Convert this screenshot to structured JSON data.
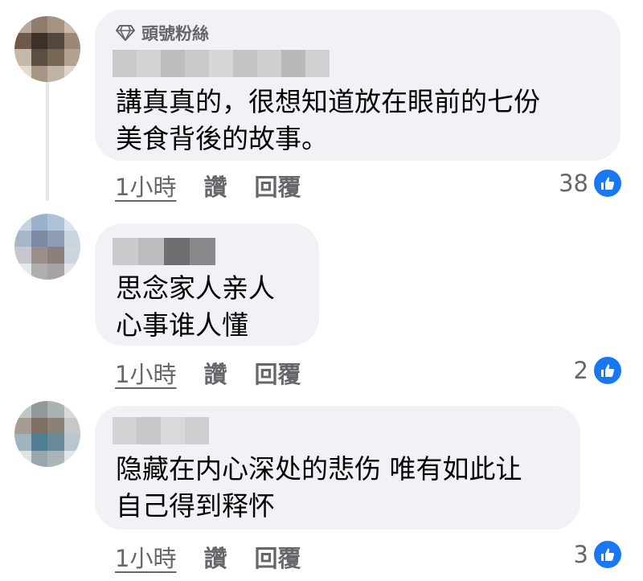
{
  "comments": [
    {
      "badge": "頭號粉絲",
      "text_lines": [
        "講真真的，很想知道放在眼前的七份",
        "美食背後的故事。"
      ],
      "time": "1小時",
      "like_label": "讚",
      "reply_label": "回覆",
      "reaction_count": "38"
    },
    {
      "text_lines": [
        "思念家人亲人",
        "心事谁人懂"
      ],
      "time": "1小時",
      "like_label": "讚",
      "reply_label": "回覆",
      "reaction_count": "2"
    },
    {
      "text_lines": [
        "隐藏在内心深处的悲伤 唯有如此让",
        "自己得到释怀"
      ],
      "time": "1小時",
      "like_label": "讚",
      "reply_label": "回覆",
      "reaction_count": "3"
    }
  ],
  "colors": {
    "bubble": "#f0f2f5",
    "secondary_text": "#65676b",
    "like_blue": "#1877f2"
  },
  "icons": {
    "badge": "diamond-icon",
    "reaction": "thumbs-up-icon"
  }
}
